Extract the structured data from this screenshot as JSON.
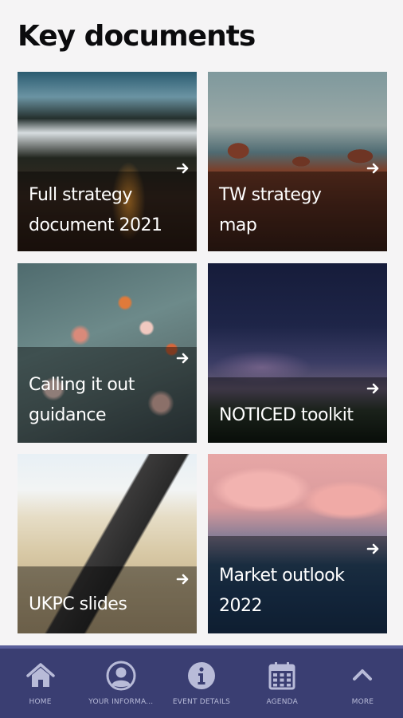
{
  "page": {
    "title": "Key documents"
  },
  "documents": [
    {
      "label": "Full strategy document 2021"
    },
    {
      "label": "TW strategy map"
    },
    {
      "label": "Calling it out guidance"
    },
    {
      "label": "NOTICED toolkit"
    },
    {
      "label": "UKPC slides"
    },
    {
      "label": "Market outlook 2022"
    }
  ],
  "bottom_nav": {
    "background": "#3a3e72",
    "items": [
      {
        "label": "HOME",
        "icon": "home-icon"
      },
      {
        "label": "YOUR INFORMA...",
        "icon": "user-icon"
      },
      {
        "label": "EVENT DETAILS",
        "icon": "info-icon"
      },
      {
        "label": "AGENDA",
        "icon": "calendar-icon"
      },
      {
        "label": "MORE",
        "icon": "chevron-up-icon"
      }
    ]
  }
}
